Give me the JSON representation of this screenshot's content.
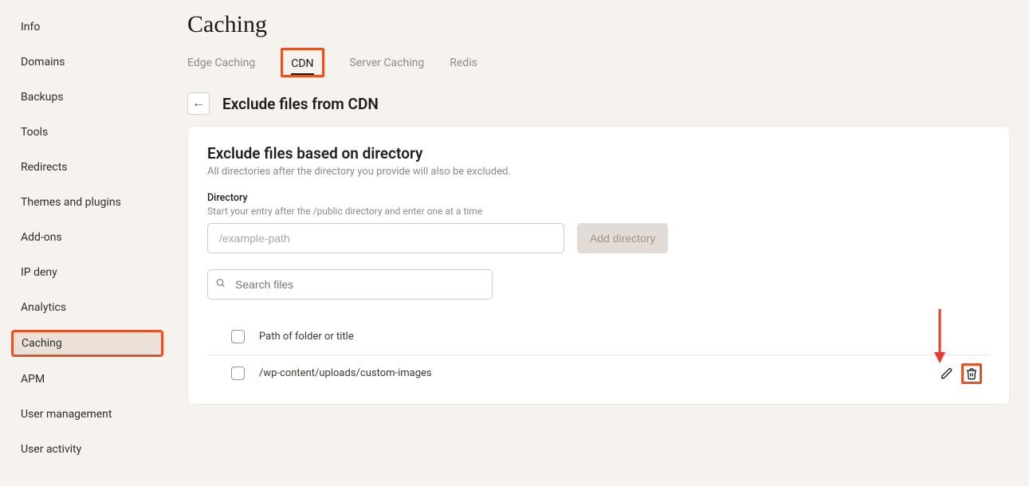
{
  "sidebar": {
    "items": [
      {
        "label": "Info"
      },
      {
        "label": "Domains"
      },
      {
        "label": "Backups"
      },
      {
        "label": "Tools"
      },
      {
        "label": "Redirects"
      },
      {
        "label": "Themes and plugins"
      },
      {
        "label": "Add-ons"
      },
      {
        "label": "IP deny"
      },
      {
        "label": "Analytics"
      },
      {
        "label": "Caching"
      },
      {
        "label": "APM"
      },
      {
        "label": "User management"
      },
      {
        "label": "User activity"
      }
    ],
    "active_index": 9
  },
  "page": {
    "title": "Caching"
  },
  "tabs": {
    "items": [
      {
        "label": "Edge Caching"
      },
      {
        "label": "CDN"
      },
      {
        "label": "Server Caching"
      },
      {
        "label": "Redis"
      }
    ],
    "active_index": 1
  },
  "subheader": {
    "title": "Exclude files from CDN"
  },
  "card": {
    "title": "Exclude files based on directory",
    "subtitle": "All directories after the directory you provide will also be excluded.",
    "directory_field": {
      "label": "Directory",
      "help": "Start your entry after the /public directory and enter one at a time",
      "placeholder": "/example-path"
    },
    "add_button_label": "Add directory",
    "search": {
      "placeholder": "Search files"
    },
    "list": {
      "header": "Path of folder or title",
      "rows": [
        {
          "path": "/wp-content/uploads/custom-images"
        }
      ]
    }
  }
}
